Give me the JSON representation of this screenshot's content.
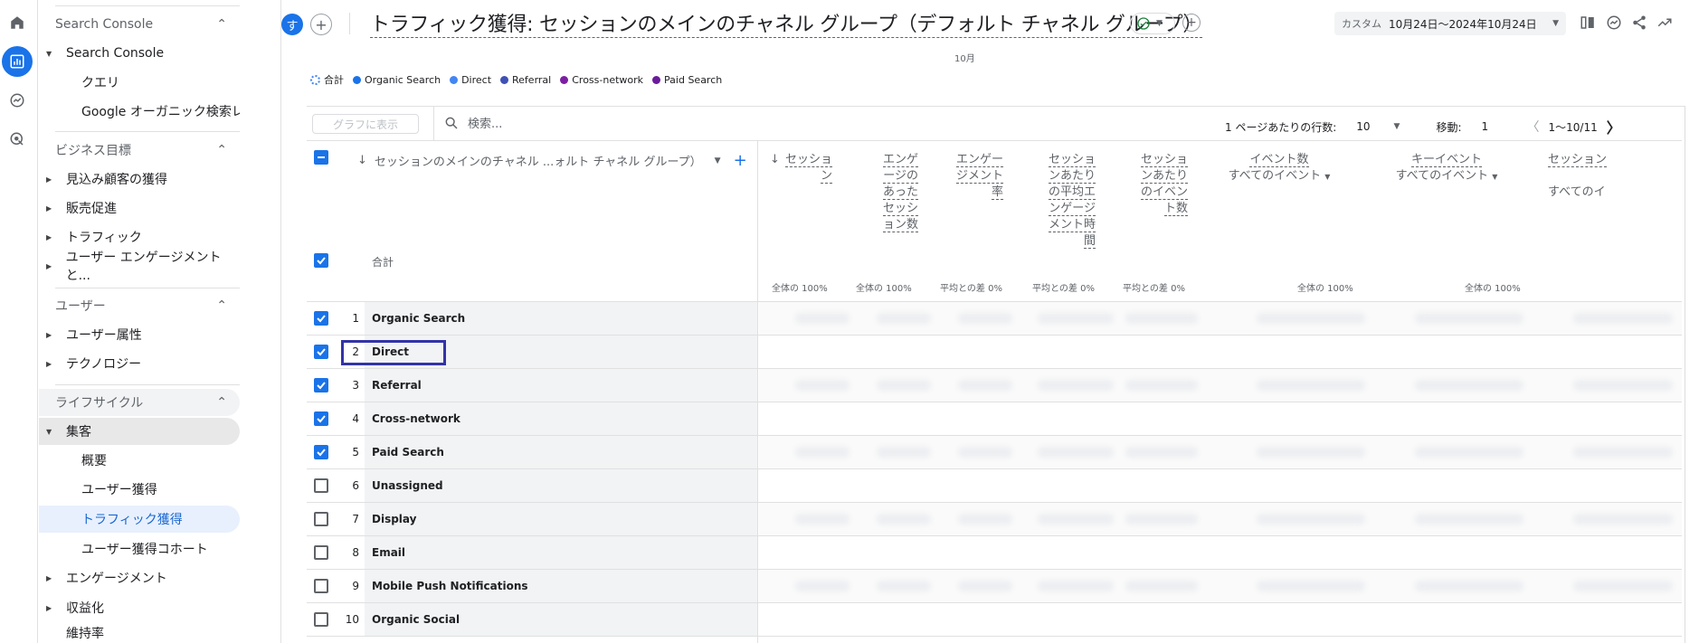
{
  "sidebar": {
    "sections": [
      {
        "title": "Search Console",
        "items": [
          {
            "label": "Search Console",
            "expanded": true,
            "children": [
              "クエリ",
              "Google オーガニック検索レ..."
            ]
          }
        ]
      },
      {
        "title": "ビジネス目標",
        "items": [
          {
            "label": "見込み顧客の獲得"
          },
          {
            "label": "販売促進"
          },
          {
            "label": "トラフィック"
          },
          {
            "label": "ユーザー エンゲージメントと..."
          }
        ]
      },
      {
        "title": "ユーザー",
        "items": [
          {
            "label": "ユーザー属性"
          },
          {
            "label": "テクノロジー"
          }
        ]
      },
      {
        "title": "ライフサイクル",
        "items": [
          {
            "label": "集客",
            "expanded": true,
            "children": [
              "概要",
              "ユーザー獲得",
              "トラフィック獲得",
              "ユーザー獲得コホート"
            ]
          },
          {
            "label": "エンゲージメント"
          },
          {
            "label": "収益化"
          },
          {
            "label": "維持率"
          }
        ]
      }
    ]
  },
  "header": {
    "avatar": "す",
    "title": "トラフィック獲得: セッションのメインのチャネル グループ（デフォルト チャネル グループ）",
    "date_label": "カスタム",
    "date_range": "10月24日～2024年10月24日"
  },
  "chart": {
    "month_label": "10月",
    "legend": [
      {
        "label": "合計",
        "color": "#ffffff",
        "outline": "#4285f4"
      },
      {
        "label": "Organic Search",
        "color": "#1a73e8"
      },
      {
        "label": "Direct",
        "color": "#4285f4"
      },
      {
        "label": "Referral",
        "color": "#3f51b5"
      },
      {
        "label": "Cross-network",
        "color": "#7b1fa2"
      },
      {
        "label": "Paid Search",
        "color": "#6a1b9a"
      }
    ]
  },
  "toolbar": {
    "graph_button": "グラフに表示",
    "search_placeholder": "検索...",
    "rows_per_page_label": "1 ページあたりの行数:",
    "rows_per_page": "10",
    "goto_label": "移動:",
    "goto_value": "1",
    "pagination": "1～10/11"
  },
  "table": {
    "dimension_header": "セッションのメインのチャネル ...ォルト チャネル グループ）",
    "total_label": "合計",
    "metric_headers": [
      {
        "lines": [
          "セッショ",
          "ン"
        ],
        "total": "全体の 100%"
      },
      {
        "lines": [
          "エンゲ",
          "ージの",
          "あった",
          "セッシ",
          "ョン数"
        ],
        "total": "全体の 100%"
      },
      {
        "lines": [
          "エンゲー",
          "ジメント",
          "率"
        ],
        "total": "平均との差 0%"
      },
      {
        "lines": [
          "セッショ",
          "ンあたり",
          "の平均エ",
          "ンゲージ",
          "メント時",
          "間"
        ],
        "total": "平均との差 0%"
      },
      {
        "lines": [
          "セッショ",
          "ンあたり",
          "のイベン",
          "ト数"
        ],
        "total": "平均との差 0%"
      },
      {
        "lines": [
          "イベント数"
        ],
        "sub": "すべてのイベント",
        "total": "全体の 100%"
      },
      {
        "lines": [
          "キーイベント"
        ],
        "sub": "すべてのイベント",
        "total": "全体の 100%"
      },
      {
        "lines": [
          "セッション"
        ],
        "sub": "すべてのイ",
        "total": ""
      }
    ],
    "rows": [
      {
        "num": "1",
        "label": "Organic Search",
        "checked": true
      },
      {
        "num": "2",
        "label": "Direct",
        "checked": true
      },
      {
        "num": "3",
        "label": "Referral",
        "checked": true
      },
      {
        "num": "4",
        "label": "Cross-network",
        "checked": true
      },
      {
        "num": "5",
        "label": "Paid Search",
        "checked": true
      },
      {
        "num": "6",
        "label": "Unassigned",
        "checked": false
      },
      {
        "num": "7",
        "label": "Display",
        "checked": false
      },
      {
        "num": "8",
        "label": "Email",
        "checked": false
      },
      {
        "num": "9",
        "label": "Mobile Push Notifications",
        "checked": false
      },
      {
        "num": "10",
        "label": "Organic Social",
        "checked": false
      }
    ]
  }
}
